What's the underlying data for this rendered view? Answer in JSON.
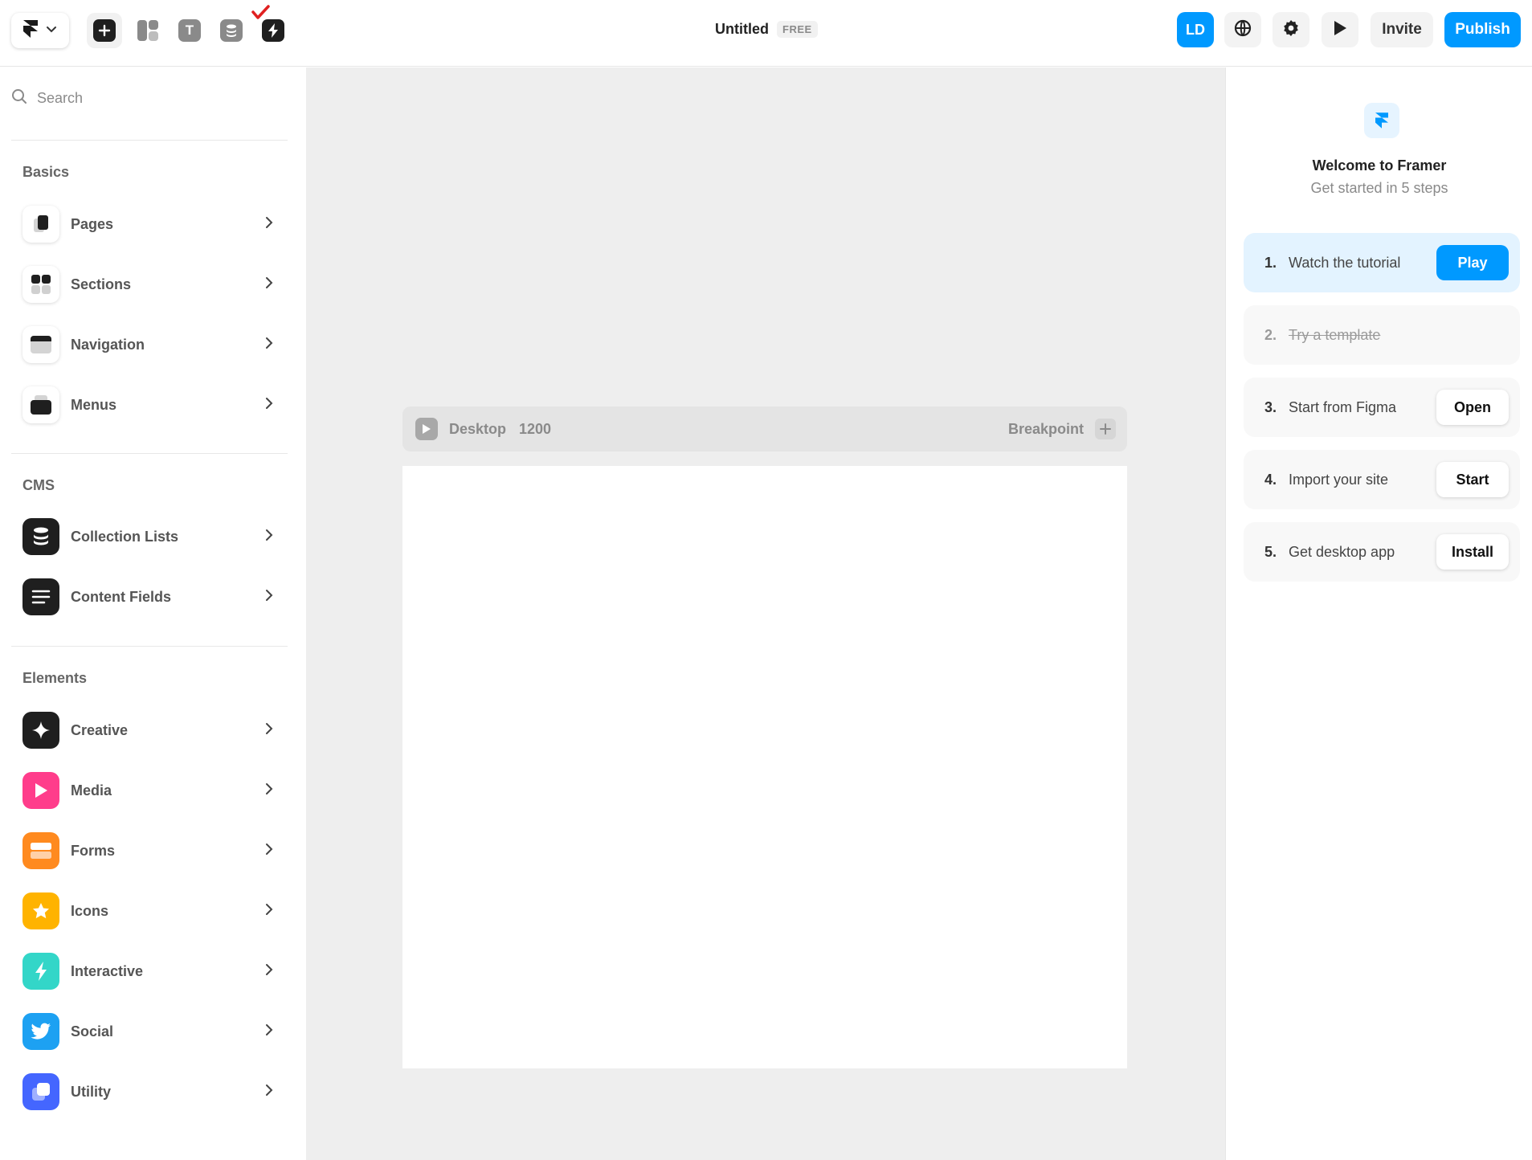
{
  "topbar": {
    "title": "Untitled",
    "plan_badge": "FREE",
    "avatar_initials": "LD",
    "invite_label": "Invite",
    "publish_label": "Publish",
    "tools": [
      "insert-icon",
      "layout-icon",
      "text-icon",
      "cms-icon",
      "interactive-icon"
    ]
  },
  "sidebar": {
    "search_placeholder": "Search",
    "sections": {
      "basics": "Basics",
      "cms": "CMS",
      "elements": "Elements"
    },
    "basics": [
      {
        "label": "Pages",
        "icon": "pages-icon"
      },
      {
        "label": "Sections",
        "icon": "sections-icon"
      },
      {
        "label": "Navigation",
        "icon": "navigation-icon"
      },
      {
        "label": "Menus",
        "icon": "menus-icon"
      }
    ],
    "cms": [
      {
        "label": "Collection Lists",
        "icon": "database-icon"
      },
      {
        "label": "Content Fields",
        "icon": "lines-icon"
      }
    ],
    "elements": [
      {
        "label": "Creative",
        "icon": "sparkle-icon",
        "color": "#1f1f1f"
      },
      {
        "label": "Media",
        "icon": "play-icon",
        "color": "#ff3d8b"
      },
      {
        "label": "Forms",
        "icon": "form-icon",
        "color": "#ff8a1f"
      },
      {
        "label": "Icons",
        "icon": "star-icon",
        "color": "#ffb300"
      },
      {
        "label": "Interactive",
        "icon": "bolt-icon",
        "color": "#33d6c8"
      },
      {
        "label": "Social",
        "icon": "twitter-icon",
        "color": "#1da1f2"
      },
      {
        "label": "Utility",
        "icon": "utility-icon",
        "color": "#4466ff"
      }
    ]
  },
  "canvas": {
    "breakpoint_name": "Desktop",
    "breakpoint_width": "1200",
    "breakpoint_label": "Breakpoint"
  },
  "onboarding": {
    "title": "Welcome to Framer",
    "subtitle": "Get started in 5 steps",
    "steps": [
      {
        "num": "1.",
        "text": "Watch the tutorial",
        "action": "Play"
      },
      {
        "num": "2.",
        "text": "Try a template",
        "action": ""
      },
      {
        "num": "3.",
        "text": "Start from Figma",
        "action": "Open"
      },
      {
        "num": "4.",
        "text": "Import your site",
        "action": "Start"
      },
      {
        "num": "5.",
        "text": "Get desktop app",
        "action": "Install"
      }
    ]
  },
  "colors": {
    "accent": "#0099ff",
    "canvas_bg": "#eeeeee"
  }
}
